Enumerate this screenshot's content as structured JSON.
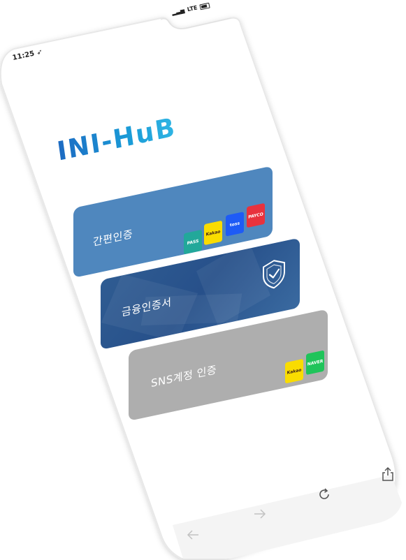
{
  "status_bar": {
    "time": "11:25",
    "network": "LTE"
  },
  "logo": {
    "text": "INI-HuB"
  },
  "cards": [
    {
      "label": "간편인증",
      "color": "#4f87be",
      "badges": [
        {
          "text": "PASS",
          "bg": "#22a89a",
          "fg": "#ffffff"
        },
        {
          "text": "Kakao",
          "bg": "#f9dc00",
          "fg": "#3a1d1d"
        },
        {
          "text": "toss",
          "bg": "#1e5bf6",
          "fg": "#ffffff"
        },
        {
          "text": "PAYCO",
          "bg": "#e8323d",
          "fg": "#ffffff"
        }
      ]
    },
    {
      "label": "금융인증서",
      "color": "#2f5c92",
      "icon": "shield-check-icon"
    },
    {
      "label": "SNS계정 인증",
      "color": "#aeaeae",
      "badges": [
        {
          "text": "Kakao",
          "bg": "#f9dc00",
          "fg": "#3a1d1d"
        },
        {
          "text": "NAVER",
          "bg": "#1fc45a",
          "fg": "#ffffff"
        }
      ]
    }
  ],
  "browser_bar": {
    "back_icon": "arrow-left-icon",
    "forward_icon": "arrow-right-icon",
    "reload_icon": "reload-icon",
    "share_icon": "share-icon"
  }
}
